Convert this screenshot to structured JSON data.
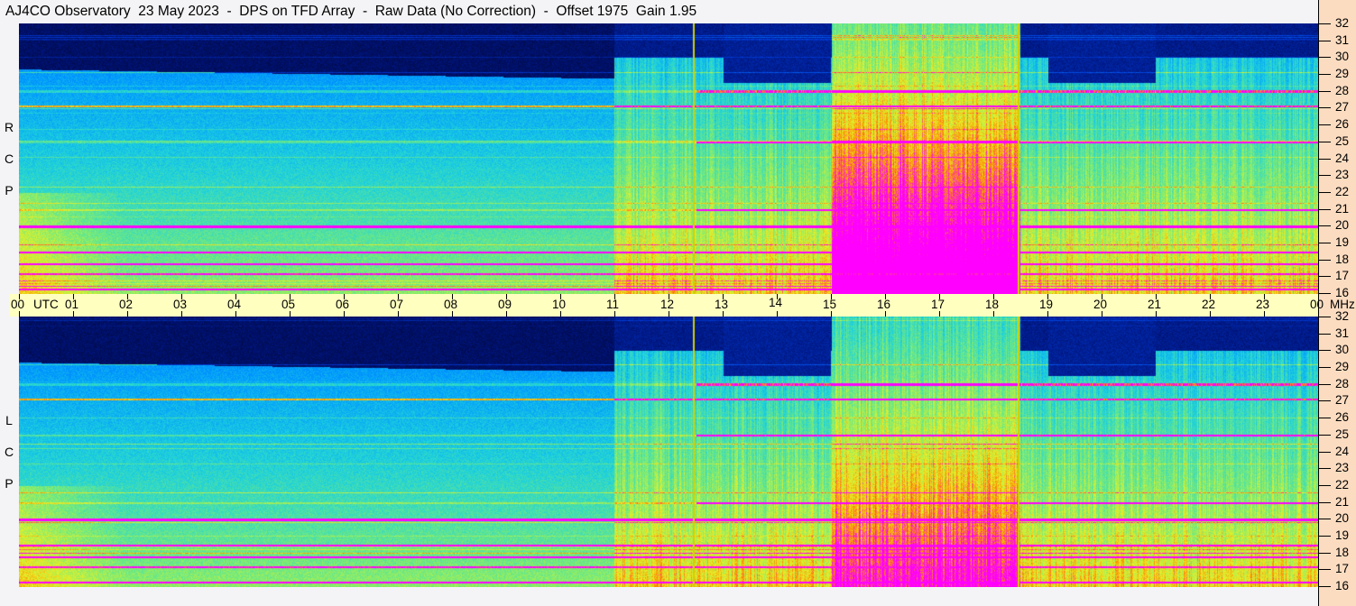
{
  "title": "AJ4CO Observatory  23 May 2023  -  DPS on TFD Array  -  Raw Data (No Correction)  -  Offset 1975  Gain 1.95",
  "chart_data": {
    "type": "heatmap",
    "title": "AJ4CO Observatory  23 May 2023  -  DPS on TFD Array  -  Raw Data (No Correction)  -  Offset 1975  Gain 1.95",
    "panels": [
      {
        "label": [
          "R",
          "C",
          "P"
        ]
      },
      {
        "label": [
          "L",
          "C",
          "P"
        ]
      }
    ],
    "x_unit": "UTC",
    "x_ticks": [
      "00",
      "01",
      "02",
      "03",
      "04",
      "05",
      "06",
      "07",
      "08",
      "09",
      "10",
      "11",
      "12",
      "13",
      "14",
      "15",
      "16",
      "17",
      "18",
      "19",
      "20",
      "21",
      "22",
      "23",
      "00"
    ],
    "xlim_hours": [
      0,
      24
    ],
    "y_unit": "MHz",
    "y_ticks": [
      "32",
      "31",
      "30",
      "29",
      "28",
      "27",
      "26",
      "25",
      "24",
      "23",
      "22",
      "21",
      "20",
      "19",
      "18",
      "17",
      "16"
    ],
    "ylim_mhz": [
      16,
      32
    ],
    "marker_lines_hours": [
      12.45,
      18.45
    ],
    "interference_mhz": [
      27.1,
      28.0,
      25.0,
      21.0,
      20.0,
      18.5,
      17.8,
      17.2,
      16.3
    ]
  }
}
